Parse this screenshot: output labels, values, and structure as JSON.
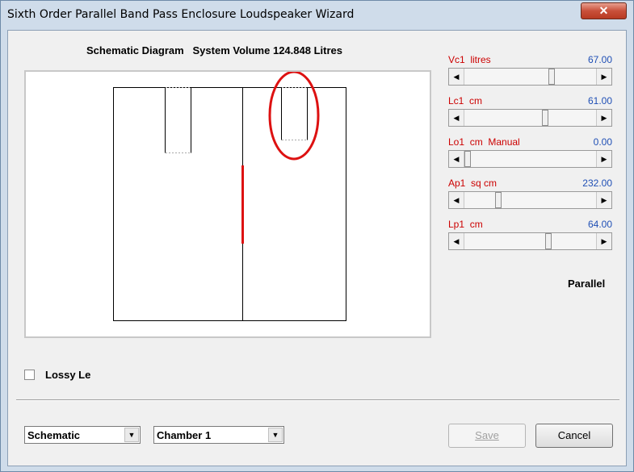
{
  "window": {
    "title": "Sixth Order Parallel Band Pass Enclosure Loudspeaker Wizard",
    "close_symbol": "✕"
  },
  "diagram": {
    "label": "Schematic Diagram   System Volume 124.848 Litres"
  },
  "controls": [
    {
      "label": "Vc1  litres",
      "value": "67.00",
      "thumb_fraction": 0.66
    },
    {
      "label": "Lc1  cm",
      "value": "61.00",
      "thumb_fraction": 0.61
    },
    {
      "label": "Lo1  cm  Manual",
      "value": "0.00",
      "thumb_fraction": 0.0
    },
    {
      "label": "Ap1  sq cm",
      "value": "232.00",
      "thumb_fraction": 0.24
    },
    {
      "label": "Lp1  cm",
      "value": "64.00",
      "thumb_fraction": 0.64
    }
  ],
  "mode_label": "Parallel",
  "lossy": {
    "label": "Lossy Le",
    "checked": false
  },
  "combos": {
    "view": "Schematic",
    "chamber": "Chamber 1"
  },
  "buttons": {
    "save": "Save",
    "cancel": "Cancel"
  },
  "icons": {
    "scroll_left": "◀",
    "scroll_right": "▶",
    "dropdown": "▼"
  },
  "colors": {
    "label_red": "#cc0000",
    "value_blue": "#1f4fb5",
    "highlight_red": "#dd1111"
  }
}
